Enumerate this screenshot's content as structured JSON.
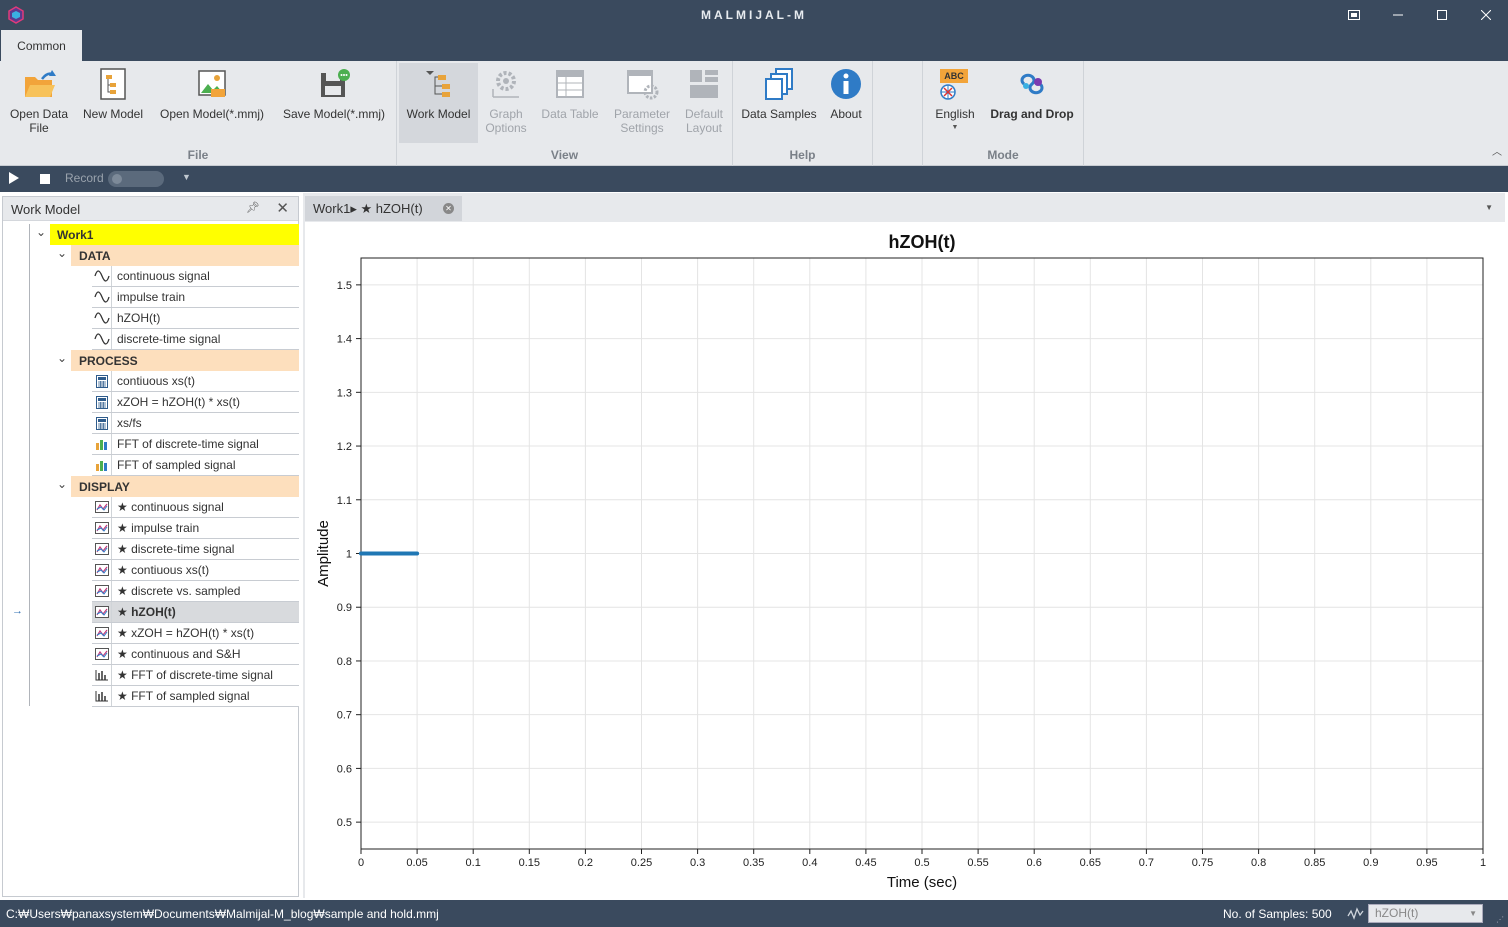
{
  "window": {
    "title": "MALMIJAL-M",
    "buttons": [
      "restore-down",
      "minimize",
      "maximize",
      "close"
    ]
  },
  "ribbon": {
    "tab": "Common",
    "groups": {
      "file": {
        "label": "File",
        "buttons": [
          "Open Data\nFile",
          "New Model",
          "Open Model(*.mmj)",
          "Save Model(*.mmj)"
        ]
      },
      "view": {
        "label": "View",
        "buttons": [
          "Work Model",
          "Graph\nOptions",
          "Data Table",
          "Parameter\nSettings",
          "Default\nLayout"
        ]
      },
      "help": {
        "label": "Help",
        "buttons": [
          "Data Samples",
          "About"
        ]
      },
      "mode": {
        "label": "Mode",
        "buttons": [
          "English",
          "Drag and Drop"
        ],
        "language_badge": "ABC"
      }
    }
  },
  "toolbar": {
    "record_label": "Record"
  },
  "work_model": {
    "title": "Work Model",
    "root": "Work1",
    "categories": [
      {
        "name": "DATA",
        "items": [
          "continuous signal",
          "impulse train",
          "hZOH(t)",
          "discrete-time signal"
        ]
      },
      {
        "name": "PROCESS",
        "items": [
          "contiuous xs(t)",
          "xZOH = hZOH(t) * xs(t)",
          "xs/fs",
          "FFT of discrete-time signal",
          "FFT of sampled signal"
        ]
      },
      {
        "name": "DISPLAY",
        "items": [
          "★ continuous signal",
          "★ impulse train",
          "★ discrete-time signal",
          "★ contiuous xs(t)",
          "★ discrete vs. sampled",
          "★ hZOH(t)",
          "★ xZOH = hZOH(t) * xs(t)",
          "★ continuous and S&H",
          "★ FFT of discrete-time signal",
          "★ FFT of sampled signal"
        ]
      }
    ],
    "selected": "★ hZOH(t)"
  },
  "document": {
    "tab_label": "Work1▸ ★ hZOH(t)"
  },
  "chart_data": {
    "type": "line",
    "title": "hZOH(t)",
    "xlabel": "Time (sec)",
    "ylabel": "Amplitude",
    "xlim": [
      0,
      1
    ],
    "ylim": [
      0.45,
      1.55
    ],
    "xticks": [
      0,
      0.05,
      0.1,
      0.15,
      0.2,
      0.25,
      0.3,
      0.35,
      0.4,
      0.45,
      0.5,
      0.55,
      0.6,
      0.65,
      0.7,
      0.75,
      0.8,
      0.85,
      0.9,
      0.95,
      1
    ],
    "yticks": [
      0.5,
      0.6,
      0.7,
      0.8,
      0.9,
      1,
      1.1,
      1.2,
      1.3,
      1.4,
      1.5
    ],
    "grid": true,
    "series": [
      {
        "x": [
          0,
          0.05
        ],
        "y": [
          1,
          1
        ],
        "color": "#1f77b4"
      }
    ]
  },
  "status": {
    "path": "C:₩Users₩panaxsystem₩Documents₩Malmijal-M_blog₩sample and hold.mmj",
    "samples": "No. of Samples: 500",
    "selection": "hZOH(t)"
  },
  "colors": {
    "chrome": "#3a4a5e",
    "ribbon": "#e7e9ec",
    "root_highlight": "#ffff00",
    "category_highlight": "#fddfbd",
    "series": "#1f77b4"
  }
}
